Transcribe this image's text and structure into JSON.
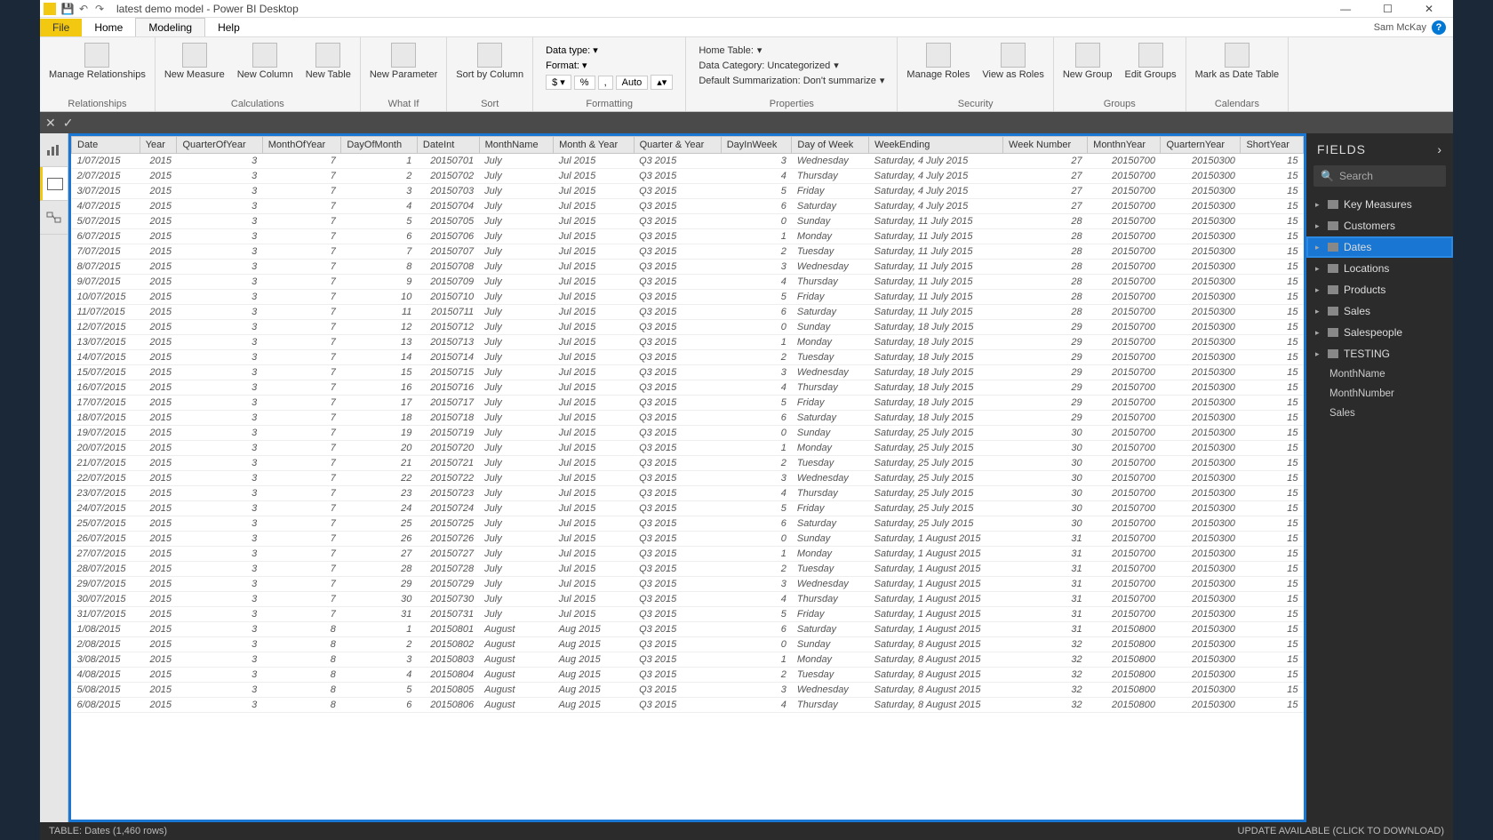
{
  "title": "latest demo model - Power BI Desktop",
  "user": "Sam McKay",
  "menu": {
    "file": "File",
    "home": "Home",
    "modeling": "Modeling",
    "help": "Help"
  },
  "ribbon": {
    "relationships": {
      "manage": "Manage\nRelationships",
      "group": "Relationships"
    },
    "calculations": {
      "measure": "New\nMeasure",
      "column": "New\nColumn",
      "table": "New\nTable",
      "group": "Calculations"
    },
    "whatif": {
      "param": "New\nParameter",
      "group": "What If"
    },
    "sort": {
      "sortby": "Sort by\nColumn",
      "group": "Sort"
    },
    "formatting": {
      "datatype": "Data type:",
      "format": "Format:",
      "auto": "Auto",
      "group": "Formatting"
    },
    "properties": {
      "hometable": "Home Table:",
      "datacat": "Data Category: Uncategorized",
      "summ": "Default Summarization: Don't summarize",
      "group": "Properties"
    },
    "security": {
      "manage": "Manage\nRoles",
      "viewas": "View as\nRoles",
      "group": "Security"
    },
    "groups": {
      "new": "New\nGroup",
      "edit": "Edit\nGroups",
      "group": "Groups"
    },
    "calendars": {
      "mark": "Mark as\nDate Table",
      "group": "Calendars"
    }
  },
  "fields": {
    "title": "FIELDS",
    "searchPlaceholder": "Search",
    "tables": [
      {
        "name": "Key Measures"
      },
      {
        "name": "Customers"
      },
      {
        "name": "Dates",
        "selected": true
      },
      {
        "name": "Locations"
      },
      {
        "name": "Products"
      },
      {
        "name": "Sales"
      },
      {
        "name": "Salespeople"
      },
      {
        "name": "TESTING",
        "expanded": true,
        "children": [
          "MonthName",
          "MonthNumber",
          "Sales"
        ]
      }
    ]
  },
  "status": {
    "left": "TABLE: Dates (1,460 rows)",
    "right": "UPDATE AVAILABLE (CLICK TO DOWNLOAD)"
  },
  "columns": [
    "Date",
    "Year",
    "QuarterOfYear",
    "MonthOfYear",
    "DayOfMonth",
    "DateInt",
    "MonthName",
    "Month & Year",
    "Quarter & Year",
    "DayInWeek",
    "Day of Week",
    "WeekEnding",
    "Week Number",
    "MonthnYear",
    "QuarternYear",
    "ShortYear"
  ],
  "numericCols": [
    1,
    2,
    3,
    4,
    5,
    9,
    12,
    13,
    14,
    15
  ],
  "rows": [
    [
      "1/07/2015",
      "2015",
      "3",
      "7",
      "1",
      "20150701",
      "July",
      "Jul 2015",
      "Q3 2015",
      "3",
      "Wednesday",
      "Saturday, 4 July 2015",
      "27",
      "20150700",
      "20150300",
      "15"
    ],
    [
      "2/07/2015",
      "2015",
      "3",
      "7",
      "2",
      "20150702",
      "July",
      "Jul 2015",
      "Q3 2015",
      "4",
      "Thursday",
      "Saturday, 4 July 2015",
      "27",
      "20150700",
      "20150300",
      "15"
    ],
    [
      "3/07/2015",
      "2015",
      "3",
      "7",
      "3",
      "20150703",
      "July",
      "Jul 2015",
      "Q3 2015",
      "5",
      "Friday",
      "Saturday, 4 July 2015",
      "27",
      "20150700",
      "20150300",
      "15"
    ],
    [
      "4/07/2015",
      "2015",
      "3",
      "7",
      "4",
      "20150704",
      "July",
      "Jul 2015",
      "Q3 2015",
      "6",
      "Saturday",
      "Saturday, 4 July 2015",
      "27",
      "20150700",
      "20150300",
      "15"
    ],
    [
      "5/07/2015",
      "2015",
      "3",
      "7",
      "5",
      "20150705",
      "July",
      "Jul 2015",
      "Q3 2015",
      "0",
      "Sunday",
      "Saturday, 11 July 2015",
      "28",
      "20150700",
      "20150300",
      "15"
    ],
    [
      "6/07/2015",
      "2015",
      "3",
      "7",
      "6",
      "20150706",
      "July",
      "Jul 2015",
      "Q3 2015",
      "1",
      "Monday",
      "Saturday, 11 July 2015",
      "28",
      "20150700",
      "20150300",
      "15"
    ],
    [
      "7/07/2015",
      "2015",
      "3",
      "7",
      "7",
      "20150707",
      "July",
      "Jul 2015",
      "Q3 2015",
      "2",
      "Tuesday",
      "Saturday, 11 July 2015",
      "28",
      "20150700",
      "20150300",
      "15"
    ],
    [
      "8/07/2015",
      "2015",
      "3",
      "7",
      "8",
      "20150708",
      "July",
      "Jul 2015",
      "Q3 2015",
      "3",
      "Wednesday",
      "Saturday, 11 July 2015",
      "28",
      "20150700",
      "20150300",
      "15"
    ],
    [
      "9/07/2015",
      "2015",
      "3",
      "7",
      "9",
      "20150709",
      "July",
      "Jul 2015",
      "Q3 2015",
      "4",
      "Thursday",
      "Saturday, 11 July 2015",
      "28",
      "20150700",
      "20150300",
      "15"
    ],
    [
      "10/07/2015",
      "2015",
      "3",
      "7",
      "10",
      "20150710",
      "July",
      "Jul 2015",
      "Q3 2015",
      "5",
      "Friday",
      "Saturday, 11 July 2015",
      "28",
      "20150700",
      "20150300",
      "15"
    ],
    [
      "11/07/2015",
      "2015",
      "3",
      "7",
      "11",
      "20150711",
      "July",
      "Jul 2015",
      "Q3 2015",
      "6",
      "Saturday",
      "Saturday, 11 July 2015",
      "28",
      "20150700",
      "20150300",
      "15"
    ],
    [
      "12/07/2015",
      "2015",
      "3",
      "7",
      "12",
      "20150712",
      "July",
      "Jul 2015",
      "Q3 2015",
      "0",
      "Sunday",
      "Saturday, 18 July 2015",
      "29",
      "20150700",
      "20150300",
      "15"
    ],
    [
      "13/07/2015",
      "2015",
      "3",
      "7",
      "13",
      "20150713",
      "July",
      "Jul 2015",
      "Q3 2015",
      "1",
      "Monday",
      "Saturday, 18 July 2015",
      "29",
      "20150700",
      "20150300",
      "15"
    ],
    [
      "14/07/2015",
      "2015",
      "3",
      "7",
      "14",
      "20150714",
      "July",
      "Jul 2015",
      "Q3 2015",
      "2",
      "Tuesday",
      "Saturday, 18 July 2015",
      "29",
      "20150700",
      "20150300",
      "15"
    ],
    [
      "15/07/2015",
      "2015",
      "3",
      "7",
      "15",
      "20150715",
      "July",
      "Jul 2015",
      "Q3 2015",
      "3",
      "Wednesday",
      "Saturday, 18 July 2015",
      "29",
      "20150700",
      "20150300",
      "15"
    ],
    [
      "16/07/2015",
      "2015",
      "3",
      "7",
      "16",
      "20150716",
      "July",
      "Jul 2015",
      "Q3 2015",
      "4",
      "Thursday",
      "Saturday, 18 July 2015",
      "29",
      "20150700",
      "20150300",
      "15"
    ],
    [
      "17/07/2015",
      "2015",
      "3",
      "7",
      "17",
      "20150717",
      "July",
      "Jul 2015",
      "Q3 2015",
      "5",
      "Friday",
      "Saturday, 18 July 2015",
      "29",
      "20150700",
      "20150300",
      "15"
    ],
    [
      "18/07/2015",
      "2015",
      "3",
      "7",
      "18",
      "20150718",
      "July",
      "Jul 2015",
      "Q3 2015",
      "6",
      "Saturday",
      "Saturday, 18 July 2015",
      "29",
      "20150700",
      "20150300",
      "15"
    ],
    [
      "19/07/2015",
      "2015",
      "3",
      "7",
      "19",
      "20150719",
      "July",
      "Jul 2015",
      "Q3 2015",
      "0",
      "Sunday",
      "Saturday, 25 July 2015",
      "30",
      "20150700",
      "20150300",
      "15"
    ],
    [
      "20/07/2015",
      "2015",
      "3",
      "7",
      "20",
      "20150720",
      "July",
      "Jul 2015",
      "Q3 2015",
      "1",
      "Monday",
      "Saturday, 25 July 2015",
      "30",
      "20150700",
      "20150300",
      "15"
    ],
    [
      "21/07/2015",
      "2015",
      "3",
      "7",
      "21",
      "20150721",
      "July",
      "Jul 2015",
      "Q3 2015",
      "2",
      "Tuesday",
      "Saturday, 25 July 2015",
      "30",
      "20150700",
      "20150300",
      "15"
    ],
    [
      "22/07/2015",
      "2015",
      "3",
      "7",
      "22",
      "20150722",
      "July",
      "Jul 2015",
      "Q3 2015",
      "3",
      "Wednesday",
      "Saturday, 25 July 2015",
      "30",
      "20150700",
      "20150300",
      "15"
    ],
    [
      "23/07/2015",
      "2015",
      "3",
      "7",
      "23",
      "20150723",
      "July",
      "Jul 2015",
      "Q3 2015",
      "4",
      "Thursday",
      "Saturday, 25 July 2015",
      "30",
      "20150700",
      "20150300",
      "15"
    ],
    [
      "24/07/2015",
      "2015",
      "3",
      "7",
      "24",
      "20150724",
      "July",
      "Jul 2015",
      "Q3 2015",
      "5",
      "Friday",
      "Saturday, 25 July 2015",
      "30",
      "20150700",
      "20150300",
      "15"
    ],
    [
      "25/07/2015",
      "2015",
      "3",
      "7",
      "25",
      "20150725",
      "July",
      "Jul 2015",
      "Q3 2015",
      "6",
      "Saturday",
      "Saturday, 25 July 2015",
      "30",
      "20150700",
      "20150300",
      "15"
    ],
    [
      "26/07/2015",
      "2015",
      "3",
      "7",
      "26",
      "20150726",
      "July",
      "Jul 2015",
      "Q3 2015",
      "0",
      "Sunday",
      "Saturday, 1 August 2015",
      "31",
      "20150700",
      "20150300",
      "15"
    ],
    [
      "27/07/2015",
      "2015",
      "3",
      "7",
      "27",
      "20150727",
      "July",
      "Jul 2015",
      "Q3 2015",
      "1",
      "Monday",
      "Saturday, 1 August 2015",
      "31",
      "20150700",
      "20150300",
      "15"
    ],
    [
      "28/07/2015",
      "2015",
      "3",
      "7",
      "28",
      "20150728",
      "July",
      "Jul 2015",
      "Q3 2015",
      "2",
      "Tuesday",
      "Saturday, 1 August 2015",
      "31",
      "20150700",
      "20150300",
      "15"
    ],
    [
      "29/07/2015",
      "2015",
      "3",
      "7",
      "29",
      "20150729",
      "July",
      "Jul 2015",
      "Q3 2015",
      "3",
      "Wednesday",
      "Saturday, 1 August 2015",
      "31",
      "20150700",
      "20150300",
      "15"
    ],
    [
      "30/07/2015",
      "2015",
      "3",
      "7",
      "30",
      "20150730",
      "July",
      "Jul 2015",
      "Q3 2015",
      "4",
      "Thursday",
      "Saturday, 1 August 2015",
      "31",
      "20150700",
      "20150300",
      "15"
    ],
    [
      "31/07/2015",
      "2015",
      "3",
      "7",
      "31",
      "20150731",
      "July",
      "Jul 2015",
      "Q3 2015",
      "5",
      "Friday",
      "Saturday, 1 August 2015",
      "31",
      "20150700",
      "20150300",
      "15"
    ],
    [
      "1/08/2015",
      "2015",
      "3",
      "8",
      "1",
      "20150801",
      "August",
      "Aug 2015",
      "Q3 2015",
      "6",
      "Saturday",
      "Saturday, 1 August 2015",
      "31",
      "20150800",
      "20150300",
      "15"
    ],
    [
      "2/08/2015",
      "2015",
      "3",
      "8",
      "2",
      "20150802",
      "August",
      "Aug 2015",
      "Q3 2015",
      "0",
      "Sunday",
      "Saturday, 8 August 2015",
      "32",
      "20150800",
      "20150300",
      "15"
    ],
    [
      "3/08/2015",
      "2015",
      "3",
      "8",
      "3",
      "20150803",
      "August",
      "Aug 2015",
      "Q3 2015",
      "1",
      "Monday",
      "Saturday, 8 August 2015",
      "32",
      "20150800",
      "20150300",
      "15"
    ],
    [
      "4/08/2015",
      "2015",
      "3",
      "8",
      "4",
      "20150804",
      "August",
      "Aug 2015",
      "Q3 2015",
      "2",
      "Tuesday",
      "Saturday, 8 August 2015",
      "32",
      "20150800",
      "20150300",
      "15"
    ],
    [
      "5/08/2015",
      "2015",
      "3",
      "8",
      "5",
      "20150805",
      "August",
      "Aug 2015",
      "Q3 2015",
      "3",
      "Wednesday",
      "Saturday, 8 August 2015",
      "32",
      "20150800",
      "20150300",
      "15"
    ],
    [
      "6/08/2015",
      "2015",
      "3",
      "8",
      "6",
      "20150806",
      "August",
      "Aug 2015",
      "Q3 2015",
      "4",
      "Thursday",
      "Saturday, 8 August 2015",
      "32",
      "20150800",
      "20150300",
      "15"
    ]
  ]
}
